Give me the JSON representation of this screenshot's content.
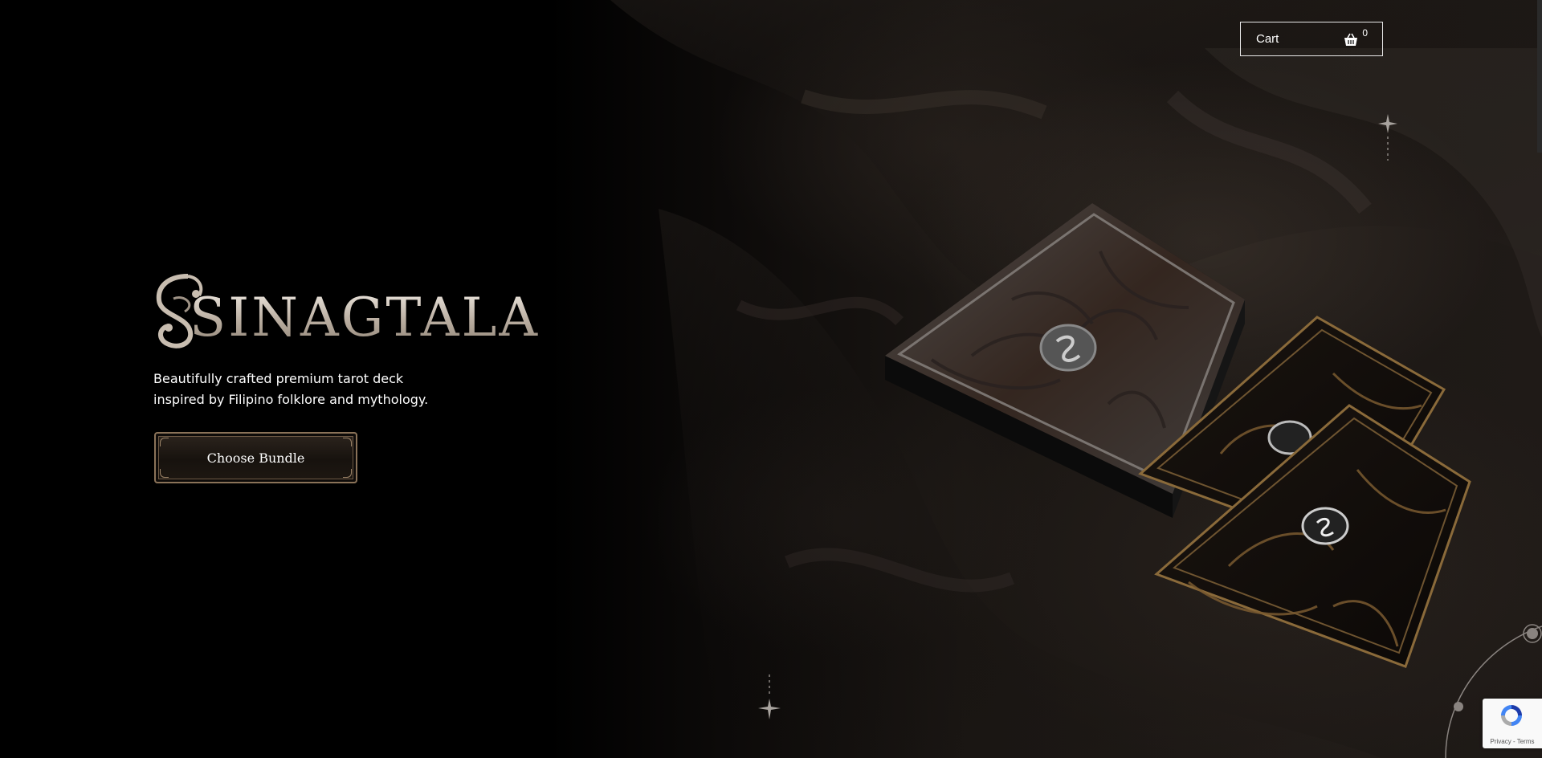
{
  "header": {
    "cart_label": "Cart",
    "cart_count": "0"
  },
  "hero": {
    "logo_text": "SINAGTALA",
    "tagline": "Beautifully crafted premium tarot deck inspired by Filipino folklore and mythology.",
    "cta_label": "Choose Bundle"
  },
  "recaptcha": {
    "links": "Privacy - Terms"
  },
  "colors": {
    "background": "#000000",
    "accent_bronze": "#8a7258",
    "text": "#ffffff"
  },
  "icons": {
    "cart": "basket-icon",
    "sparkles": "sparkle-star-icon",
    "recaptcha": "recaptcha-icon"
  }
}
